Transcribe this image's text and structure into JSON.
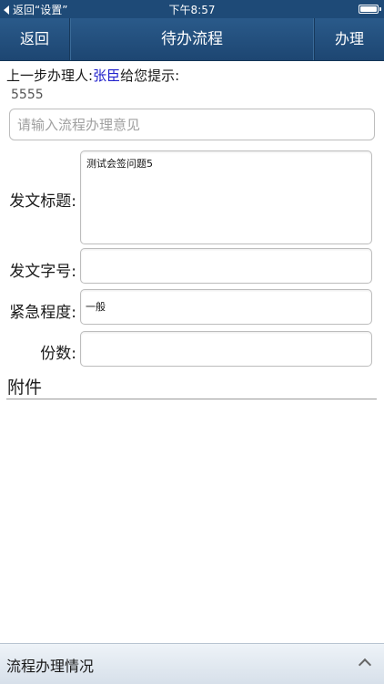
{
  "status_bar": {
    "back_app": "返回“设置”",
    "time": "下午8:57"
  },
  "nav": {
    "back_label": "返回",
    "title": "待办流程",
    "action_label": "办理"
  },
  "hint": {
    "prefix": "上一步办理人:",
    "name": "张臣",
    "suffix": "给您提示:",
    "message": "5555"
  },
  "opinion": {
    "placeholder": "请输入流程办理意见",
    "value": ""
  },
  "fields": [
    {
      "label": "发文标题:",
      "value": "测试会签问题5"
    },
    {
      "label": "发文字号:",
      "value": ""
    },
    {
      "label": "紧急程度:",
      "value": "一般"
    },
    {
      "label": "份数:",
      "value": ""
    }
  ],
  "attachments": {
    "title": "附件"
  },
  "bottom_bar": {
    "label": "流程办理情况",
    "icon": "chevron-up-icon"
  },
  "colors": {
    "nav_bg": "#1d4672",
    "name_link": "#2222cc"
  }
}
